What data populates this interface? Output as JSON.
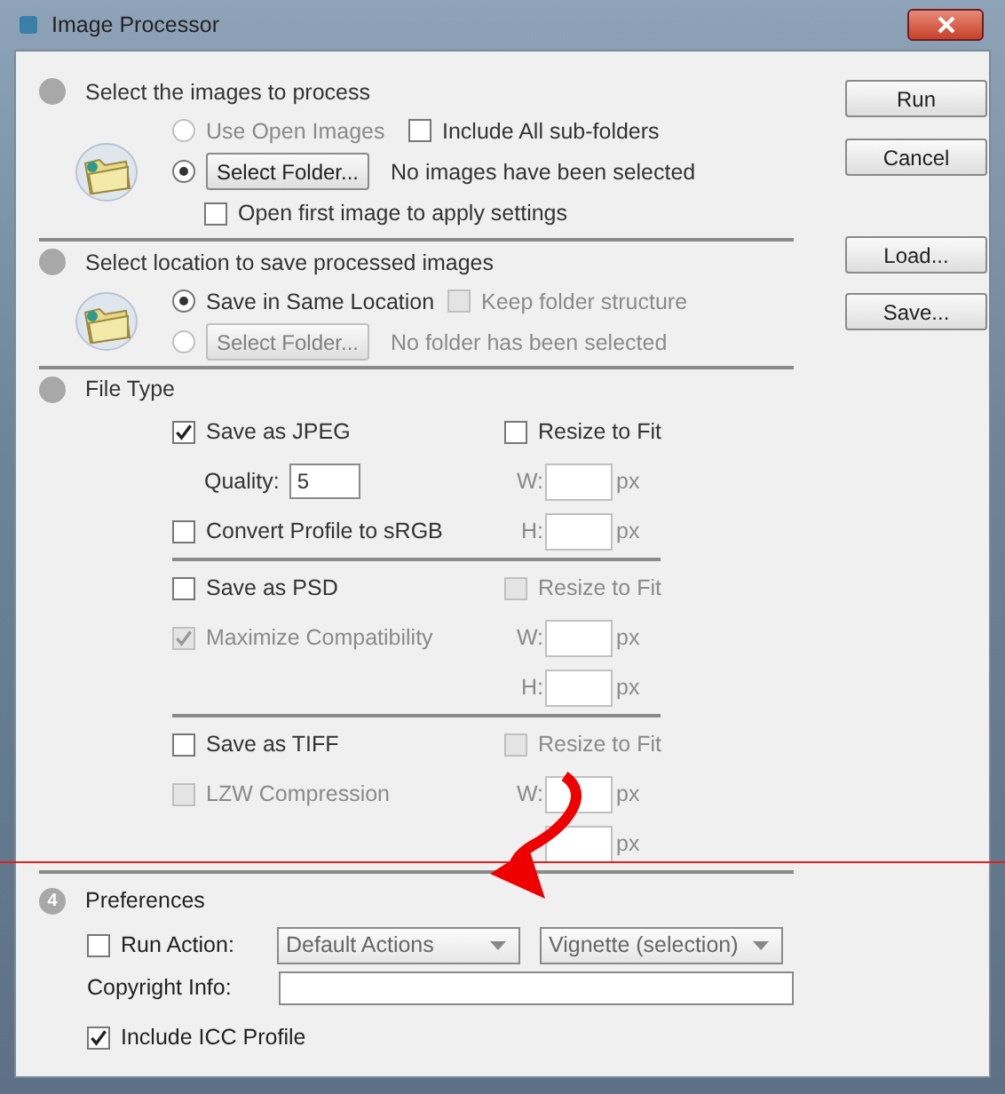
{
  "window": {
    "title": "Image Processor"
  },
  "buttons": [
    {
      "label": "Run"
    },
    {
      "label": "Cancel"
    },
    {
      "label": "Load..."
    },
    {
      "label": "Save..."
    }
  ],
  "source": {
    "title": "Select the images to process",
    "use_open": {
      "label": "Use Open Images",
      "selected": false,
      "disabled": true
    },
    "subfolders": {
      "label": "Include All sub-folders",
      "checked": false,
      "disabled": false
    },
    "folder": {
      "selected": true,
      "disabled": false,
      "button": "Select Folder...",
      "status": "No images have been selected"
    },
    "open_first": {
      "label": "Open first image to apply settings",
      "checked": false,
      "disabled": false
    }
  },
  "destination": {
    "title": "Select location to save processed images",
    "same": {
      "label": "Save in Same Location",
      "selected": true,
      "disabled": false
    },
    "keep": {
      "label": "Keep folder structure",
      "checked": false,
      "disabled": true
    },
    "folder": {
      "selected": false,
      "disabled": true,
      "button": "Select Folder...",
      "status": "No folder has been selected"
    }
  },
  "file_type": {
    "title": "File Type",
    "groups": [
      {
        "rows": [
          {
            "left": {
              "kind": "checkbox",
              "label": "Save as JPEG",
              "checked": true,
              "disabled": false
            },
            "right": {
              "kind": "checkbox",
              "label": "Resize to Fit",
              "checked": false,
              "disabled": false
            }
          },
          {
            "left": {
              "kind": "quality",
              "label": "Quality:",
              "value": "5"
            },
            "right": {
              "kind": "dimension",
              "label": "W:",
              "unit": "px",
              "disabled": true
            }
          },
          {
            "left": {
              "kind": "checkbox",
              "label": "Convert Profile to sRGB",
              "checked": false,
              "disabled": false
            },
            "right": {
              "kind": "dimension",
              "label": "H:",
              "unit": "px",
              "disabled": true
            }
          }
        ]
      },
      {
        "rows": [
          {
            "left": {
              "kind": "checkbox",
              "label": "Save as PSD",
              "checked": false,
              "disabled": false
            },
            "right": {
              "kind": "checkbox",
              "label": "Resize to Fit",
              "checked": false,
              "disabled": true
            }
          },
          {
            "left": {
              "kind": "checkbox",
              "label": "Maximize Compatibility",
              "checked": true,
              "disabled": true
            },
            "right": {
              "kind": "dimension",
              "label": "W:",
              "unit": "px",
              "disabled": true
            }
          },
          {
            "right": {
              "kind": "dimension",
              "label": "H:",
              "unit": "px",
              "disabled": true
            }
          }
        ]
      },
      {
        "rows": [
          {
            "left": {
              "kind": "checkbox",
              "label": "Save as TIFF",
              "checked": false,
              "disabled": false
            },
            "right": {
              "kind": "checkbox",
              "label": "Resize to Fit",
              "checked": false,
              "disabled": true
            }
          },
          {
            "left": {
              "kind": "checkbox",
              "label": "LZW Compression",
              "checked": false,
              "disabled": true
            },
            "right": {
              "kind": "dimension",
              "label": "W:",
              "unit": "px",
              "disabled": true
            }
          },
          {
            "right": {
              "kind": "dimension",
              "unit": "px",
              "disabled": true
            }
          }
        ]
      }
    ]
  },
  "preferences": {
    "number": "4",
    "title": "Preferences",
    "run_action": {
      "label": "Run Action:",
      "checked": false
    },
    "action_set": "Default Actions",
    "action": "Vignette (selection)",
    "copyright": {
      "label": "Copyright Info:"
    },
    "icc": {
      "label": "Include ICC Profile",
      "checked": true
    }
  }
}
